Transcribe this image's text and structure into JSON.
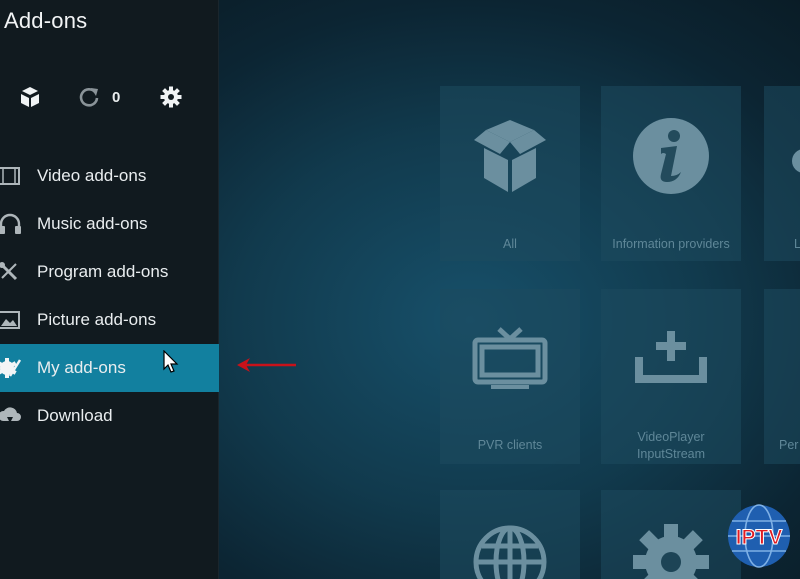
{
  "window": {
    "title": "Add-ons"
  },
  "toolbar": {
    "addon_browser_icon": "open-box-icon",
    "update_icon": "refresh-icon",
    "update_count": "0",
    "settings_icon": "gear-icon"
  },
  "menu": {
    "items": [
      {
        "label": "Video add-ons",
        "icon": "film-strip-icon"
      },
      {
        "label": "Music add-ons",
        "icon": "headphones-icon"
      },
      {
        "label": "Program add-ons",
        "icon": "tools-icon"
      },
      {
        "label": "Picture add-ons",
        "icon": "picture-icon"
      },
      {
        "label": "My add-ons",
        "icon": "puzzle-gear-icon",
        "selected": true
      },
      {
        "label": "Download",
        "icon": "cloud-download-icon"
      }
    ]
  },
  "tiles": [
    {
      "label": "All",
      "icon": "open-box-icon"
    },
    {
      "label": "Information providers",
      "icon": "info-circle-icon"
    },
    {
      "label": "L",
      "icon": "partial-icon"
    },
    {
      "label": "PVR clients",
      "icon": "tv-icon"
    },
    {
      "label": "VideoPlayer\nInputStream",
      "label_line1": "VideoPlayer",
      "label_line2": "InputStream",
      "icon": "tray-plus-icon"
    },
    {
      "label": "Per",
      "icon": "partial-icon"
    },
    {
      "label": "",
      "icon": "globe-icon"
    },
    {
      "label": "",
      "icon": "gear-icon"
    }
  ],
  "badge": {
    "text": "IPTV"
  },
  "colors": {
    "sidebar_bg": "#111a1f",
    "selected_bg": "#12809f",
    "arrow": "#c8121a",
    "tile_text": "#5f8798"
  }
}
